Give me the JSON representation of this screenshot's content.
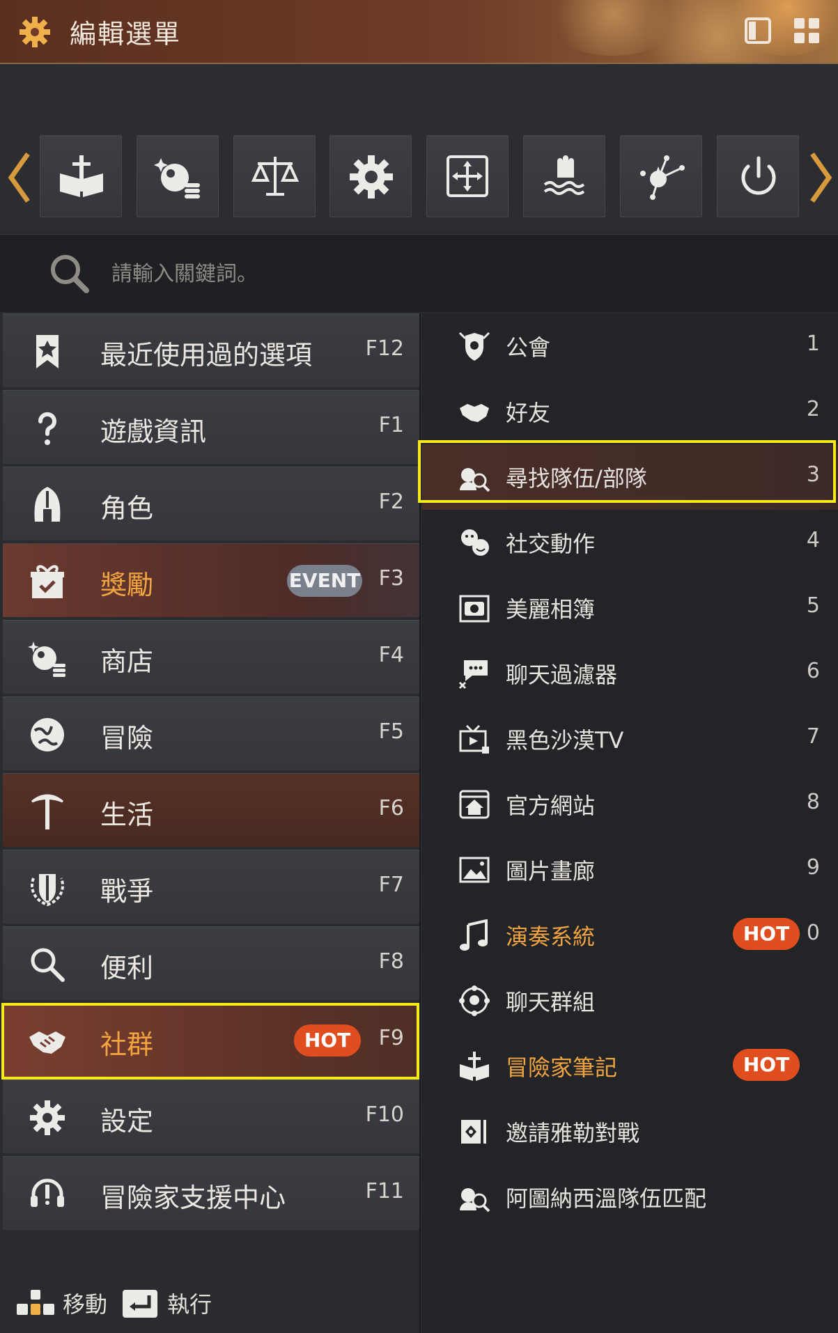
{
  "header": {
    "title": "編輯選單"
  },
  "search": {
    "placeholder": "請輸入關鍵詞。"
  },
  "toolbar": {
    "icons": [
      "book-sword-icon",
      "pearl-shop-icon",
      "scales-icon",
      "gear-icon",
      "move-frame-icon",
      "hand-water-icon",
      "node-star-icon",
      "power-icon"
    ]
  },
  "menu": [
    {
      "label": "最近使用過的選項",
      "key": "F12",
      "icon": "bookmark-star-icon"
    },
    {
      "label": "遊戲資訊",
      "key": "F1",
      "icon": "question-icon"
    },
    {
      "label": "角色",
      "key": "F2",
      "icon": "helmet-icon"
    },
    {
      "label": "獎勵",
      "key": "F3",
      "icon": "gift-icon",
      "badge": "EVENT"
    },
    {
      "label": "商店",
      "key": "F4",
      "icon": "pearl-shop-icon"
    },
    {
      "label": "冒險",
      "key": "F5",
      "icon": "globe-icon"
    },
    {
      "label": "生活",
      "key": "F6",
      "icon": "pickaxe-icon"
    },
    {
      "label": "戰爭",
      "key": "F7",
      "icon": "shield-wreath-icon"
    },
    {
      "label": "便利",
      "key": "F8",
      "icon": "magnifier-icon"
    },
    {
      "label": "社群",
      "key": "F9",
      "icon": "handshake-icon",
      "badge": "HOT"
    },
    {
      "label": "設定",
      "key": "F10",
      "icon": "gear-icon"
    },
    {
      "label": "冒險家支援中心",
      "key": "F11",
      "icon": "headset-icon"
    }
  ],
  "submenu": [
    {
      "label": "公會",
      "num": "1",
      "icon": "guild-crest-icon"
    },
    {
      "label": "好友",
      "num": "2",
      "icon": "handshake-icon"
    },
    {
      "label": "尋找隊伍/部隊",
      "num": "3",
      "icon": "party-search-icon"
    },
    {
      "label": "社交動作",
      "num": "4",
      "icon": "emote-icon"
    },
    {
      "label": "美麗相簿",
      "num": "5",
      "icon": "camera-icon"
    },
    {
      "label": "聊天過濾器",
      "num": "6",
      "icon": "chat-filter-icon"
    },
    {
      "label": "黑色沙漠TV",
      "num": "7",
      "icon": "tv-icon"
    },
    {
      "label": "官方網站",
      "num": "8",
      "icon": "home-page-icon"
    },
    {
      "label": "圖片畫廊",
      "num": "9",
      "icon": "picture-icon"
    },
    {
      "label": "演奏系統",
      "num": "0",
      "icon": "music-note-icon",
      "badge": "HOT"
    },
    {
      "label": "聊天群組",
      "num": "",
      "icon": "chat-group-icon"
    },
    {
      "label": "冒險家筆記",
      "num": "",
      "icon": "book-sword-icon",
      "badge": "HOT"
    },
    {
      "label": "邀請雅勒對戰",
      "num": "",
      "icon": "invite-duel-icon"
    },
    {
      "label": "阿圖納西溫隊伍匹配",
      "num": "",
      "icon": "party-search-icon"
    }
  ],
  "hints": {
    "move": "移動",
    "execute": "執行"
  },
  "colors": {
    "accent": "#f2a441",
    "hot": "#e04e1f",
    "highlight": "#f6ea1a"
  }
}
